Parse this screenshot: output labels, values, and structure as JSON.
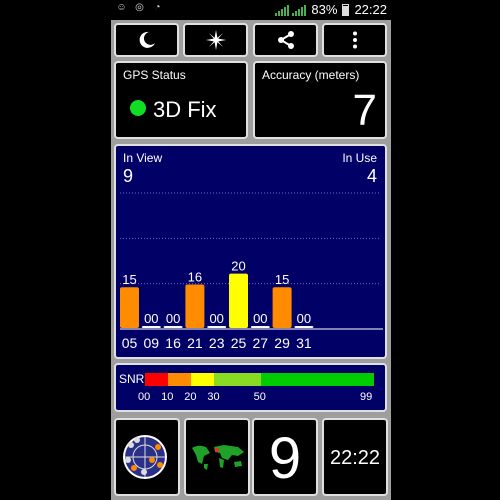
{
  "status_bar": {
    "battery_percent": "83%",
    "time": "22:22",
    "icons": [
      "notification-icon",
      "gps-icon",
      "wifi-icon",
      "signal-icon",
      "battery-icon"
    ]
  },
  "toolbar": {
    "buttons": [
      {
        "icon": "moon-icon"
      },
      {
        "icon": "compass-star-icon"
      },
      {
        "icon": "share-icon"
      },
      {
        "icon": "more-vert-icon"
      }
    ]
  },
  "gps_status": {
    "label": "GPS Status",
    "fix": "3D Fix",
    "fix_color": "#11dd22"
  },
  "accuracy": {
    "label": "Accuracy (meters)",
    "value": "7"
  },
  "satellites": {
    "in_view_label": "In View",
    "in_view": "9",
    "in_use_label": "In Use",
    "in_use": "4",
    "background": "#000066"
  },
  "chart_data": {
    "type": "bar",
    "categories": [
      "05",
      "09",
      "16",
      "21",
      "23",
      "25",
      "27",
      "29",
      "31"
    ],
    "values": [
      15,
      0,
      0,
      16,
      0,
      20,
      0,
      15,
      0
    ],
    "value_labels": [
      "15",
      "00",
      "00",
      "16",
      "00",
      "20",
      "00",
      "15",
      "00"
    ],
    "colors": [
      "#ff8c00",
      "#ffffff",
      "#ffffff",
      "#ff8c00",
      "#ffffff",
      "#ffff00",
      "#ffffff",
      "#ff8c00",
      "#ffffff"
    ],
    "ylim": [
      0,
      50
    ],
    "grid": true
  },
  "snr": {
    "label": "SNR",
    "segments": [
      {
        "from": 0,
        "to": 10,
        "color": "#ff0000"
      },
      {
        "from": 10,
        "to": 20,
        "color": "#ff8c00"
      },
      {
        "from": 20,
        "to": 30,
        "color": "#ffff00"
      },
      {
        "from": 30,
        "to": 50,
        "color": "#88dd22"
      },
      {
        "from": 50,
        "to": 99,
        "color": "#00cc00"
      }
    ],
    "ticks": [
      "00",
      "10",
      "20",
      "30",
      "50",
      "99"
    ],
    "tick_values": [
      0,
      10,
      20,
      30,
      50,
      99
    ]
  },
  "bottom": {
    "sky_icon": "sky-view-icon",
    "map_icon": "world-map-icon",
    "count": "9",
    "time": "22:22"
  }
}
